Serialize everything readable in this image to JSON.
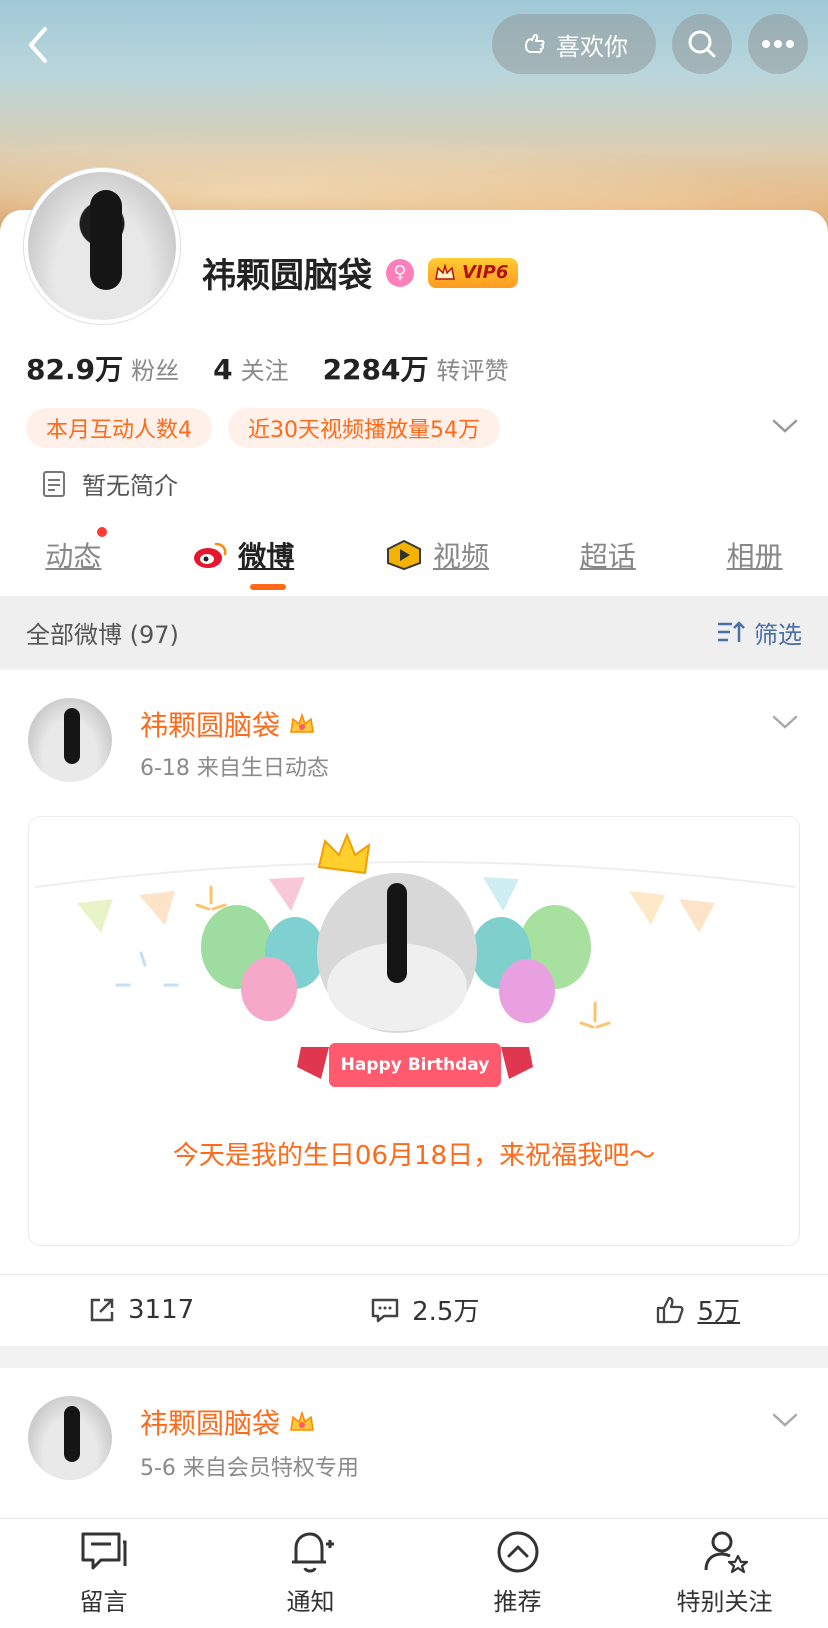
{
  "header": {
    "like_label": "喜欢你"
  },
  "profile": {
    "name": "祎颗圆脑袋",
    "vip_label": "VIP6",
    "stats": [
      {
        "value": "82.9万",
        "label": "粉丝"
      },
      {
        "value": "4",
        "label": "关注"
      },
      {
        "value": "2284万",
        "label": "转评赞"
      }
    ],
    "tags": [
      "本月互动人数4",
      "近30天视频播放量54万"
    ],
    "bio": "暂无简介",
    "tabs": [
      "动态",
      "微博",
      "视频",
      "超话",
      "相册"
    ]
  },
  "filter": {
    "left_label": "全部微博 (97)",
    "right_label": "筛选"
  },
  "post1": {
    "author": "祎颗圆脑袋",
    "meta": "6-18  来自生日动态",
    "card_text": "今天是我的生日06月18日，来祝福我吧～",
    "ribbon_text": "Happy Birthday",
    "repost_count": "3117",
    "comment_count": "2.5万",
    "like_count": "5万"
  },
  "post2": {
    "author": "祎颗圆脑袋",
    "meta": "5-6  来自会员特权专用"
  },
  "bottom_bar": {
    "items": [
      "留言",
      "通知",
      "推荐",
      "特别关注"
    ]
  },
  "colors": {
    "accent": "#ff6a1a",
    "link_blue": "#4a6ea8"
  }
}
